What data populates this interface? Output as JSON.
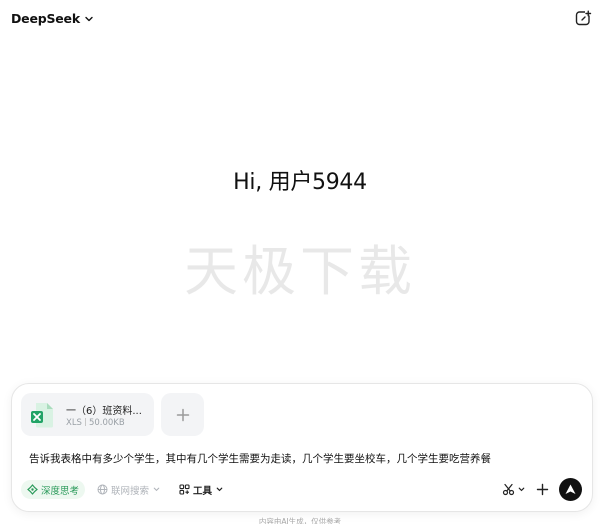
{
  "header": {
    "brand": "DeepSeek",
    "brand_icon": "chevron-down-icon",
    "new_chat_icon": "new-chat-icon"
  },
  "main": {
    "greeting": "Hi, 用户5944",
    "watermark": "天极下载"
  },
  "composer": {
    "attachment": {
      "name": "一（6）班资料...",
      "type": "XLS",
      "size": "50.00KB",
      "icon": "excel-file-icon",
      "accent": "#21a366"
    },
    "add_icon": "plus-icon",
    "prompt": "告诉我表格中有多少个学生，其中有几个学生需要为走读，几个学生要坐校车，几个学生要吃营养餐",
    "deep_think_label": "深度思考",
    "web_search_label": "联网搜索",
    "tools_label": "工具",
    "send_color": "#111111",
    "deep_color": "#2a9a5a"
  },
  "footer": {
    "disclaimer": "内容由AI生成，仅供参考"
  }
}
